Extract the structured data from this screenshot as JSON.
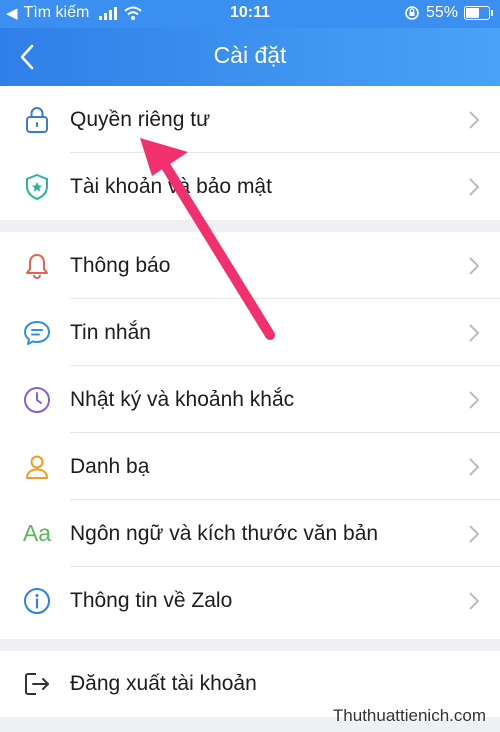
{
  "status_bar": {
    "back_app": "Tìm kiếm",
    "time": "10:11",
    "battery_text": "55%",
    "battery_level": 0.55
  },
  "header": {
    "title": "Cài đặt",
    "back_icon": "chevron-left-icon"
  },
  "groups": [
    {
      "items": [
        {
          "name": "privacy",
          "label": "Quyền riêng tư",
          "icon": "lock-icon",
          "color": "#3a7bd5"
        },
        {
          "name": "account-security",
          "label": "Tài khoản và bảo mật",
          "icon": "shield-icon",
          "color": "#2bb3a0"
        }
      ]
    },
    {
      "items": [
        {
          "name": "notifications",
          "label": "Thông báo",
          "icon": "bell-icon",
          "color": "#e8604c"
        },
        {
          "name": "messages",
          "label": "Tin nhắn",
          "icon": "chat-bubble-icon",
          "color": "#2f8fe8"
        },
        {
          "name": "diary",
          "label": "Nhật ký và khoảnh khắc",
          "icon": "clock-icon",
          "color": "#8a5fd6"
        },
        {
          "name": "contacts",
          "label": "Danh bạ",
          "icon": "person-icon",
          "color": "#f0a020"
        },
        {
          "name": "language",
          "label": "Ngôn ngữ và kích thước văn bản",
          "icon": "text-size-icon",
          "icon_text": "Aa",
          "color": "#5cb85c"
        },
        {
          "name": "about",
          "label": "Thông tin về Zalo",
          "icon": "info-icon",
          "color": "#2f7fe8"
        }
      ]
    },
    {
      "items": [
        {
          "name": "logout",
          "label": "Đăng xuất tài khoản",
          "icon": "logout-icon",
          "color": "#333333"
        }
      ]
    }
  ],
  "annotation": {
    "color": "#f2306e"
  },
  "watermark": "Thuthuattienich.com"
}
